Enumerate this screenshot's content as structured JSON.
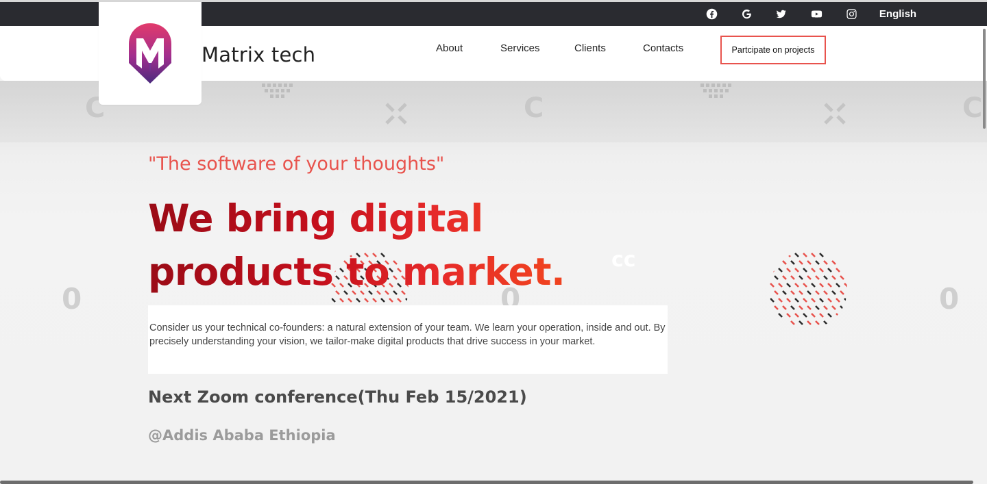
{
  "topbar": {
    "social": [
      {
        "icon": "facebook-icon",
        "label": "Facebook"
      },
      {
        "icon": "google-icon",
        "label": "Google"
      },
      {
        "icon": "twitter-icon",
        "label": "Twitter"
      },
      {
        "icon": "youtube-icon",
        "label": "YouTube"
      },
      {
        "icon": "instagram-icon",
        "label": "Instagram"
      }
    ],
    "language": "English"
  },
  "header": {
    "brand": "Matrix tech",
    "logo_letter": "M",
    "nav": [
      "About",
      "Services",
      "Clients",
      "Contacts"
    ],
    "cta": "Partcipate on projects"
  },
  "hero": {
    "quote": "\"The software of your thoughts\"",
    "headline_line1": "We bring digital",
    "headline_line2": "products to market.",
    "description": "Consider us your technical co-founders: a natural extension of your team. We learn your operation, inside and out. By precisely understanding your vision, we tailor-make digital products that drive success in your market.",
    "zoom": "Next Zoom conference(Thu Feb 15/2021)",
    "location": "@Addis Ababa Ethiopia"
  },
  "colors": {
    "topbar": "#2a2b30",
    "accent": "#e8534d",
    "headline_dark": "#9a0b16",
    "headline_light": "#f0431f"
  }
}
